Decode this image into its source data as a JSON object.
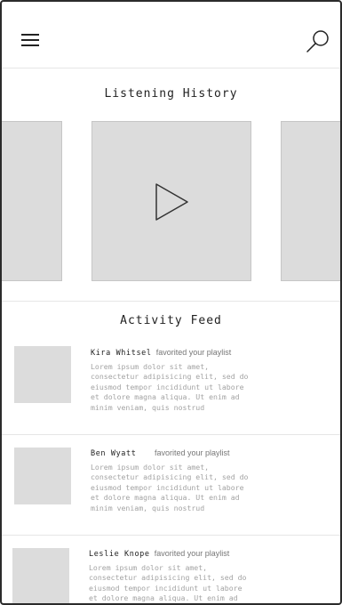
{
  "header": {
    "menu_icon": "hamburger-menu-icon",
    "search_icon": "magnifier-icon"
  },
  "listening_history": {
    "title": "Listening History",
    "play_icon": "play-triangle-icon"
  },
  "activity_feed": {
    "title": "Activity Feed",
    "items": [
      {
        "name": "Kira Whitsel",
        "action": "favorited your playlist",
        "body": "Lorem ipsum dolor sit amet,\nconsectetur adipisicing elit, sed do\neiusmod tempor incididunt ut labore\net dolore magna aliqua. Ut enim ad\nminim veniam, quis nostrud"
      },
      {
        "name": "Ben Wyatt",
        "action": "favorited your playlist",
        "body": "Lorem ipsum dolor sit amet,\nconsectetur adipisicing elit, sed do\neiusmod tempor incididunt ut labore\net dolore magna aliqua. Ut enim ad\nminim veniam, quis nostrud"
      },
      {
        "name": "Leslie Knope",
        "action": "favorited your playlist",
        "body": "Lorem ipsum dolor sit amet,\nconsectetur adipisicing elit, sed do\neiusmod tempor incididunt ut labore\net dolore magna aliqua. Ut enim ad\nminim veniam, quis nostrud"
      }
    ]
  }
}
